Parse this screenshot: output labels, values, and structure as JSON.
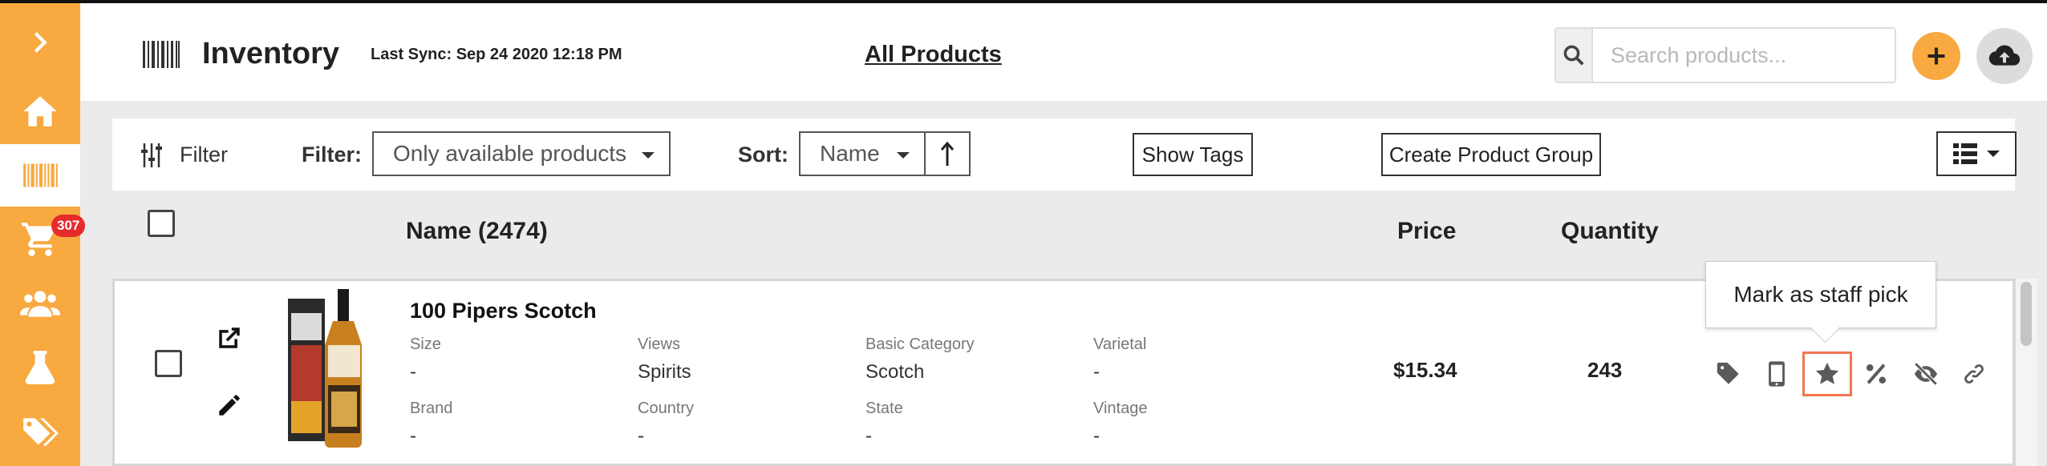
{
  "colors": {
    "accent": "#f8a940",
    "badge": "#e52b2b",
    "highlight": "#f2764f"
  },
  "sidebar": {
    "items": [
      {
        "icon": "chevron-right-icon"
      },
      {
        "icon": "home-icon"
      },
      {
        "icon": "barcode-icon",
        "active": true
      },
      {
        "icon": "cart-icon",
        "badge": "307"
      },
      {
        "icon": "users-icon"
      },
      {
        "icon": "flask-icon"
      },
      {
        "icon": "tags-icon"
      }
    ]
  },
  "header": {
    "title": "Inventory",
    "last_sync": "Last Sync: Sep 24 2020 12:18 PM",
    "view_link": "All Products",
    "search_placeholder": "Search products..."
  },
  "toolbar": {
    "filter_toggle": "Filter",
    "filter_label": "Filter:",
    "filter_value": "Only available products",
    "sort_label": "Sort:",
    "sort_value": "Name",
    "show_tags": "Show Tags",
    "create_group": "Create Product Group"
  },
  "columns": {
    "name": "Name  (2474)",
    "price": "Price",
    "quantity": "Quantity"
  },
  "product": {
    "name": "100 Pipers Scotch",
    "attributes": [
      {
        "label": "Size",
        "value": "-"
      },
      {
        "label": "Views",
        "value": "Spirits"
      },
      {
        "label": "Basic Category",
        "value": "Scotch"
      },
      {
        "label": "Varietal",
        "value": "-"
      },
      {
        "label": "Brand",
        "value": "-"
      },
      {
        "label": "Country",
        "value": "-"
      },
      {
        "label": "State",
        "value": "-"
      },
      {
        "label": "Vintage",
        "value": "-"
      }
    ],
    "price": "$15.34",
    "quantity": "243",
    "actions": [
      "tag-icon",
      "mobile-icon",
      "star-icon",
      "percent-icon",
      "eye-slash-icon",
      "link-icon"
    ]
  },
  "tooltip": "Mark as staff pick"
}
